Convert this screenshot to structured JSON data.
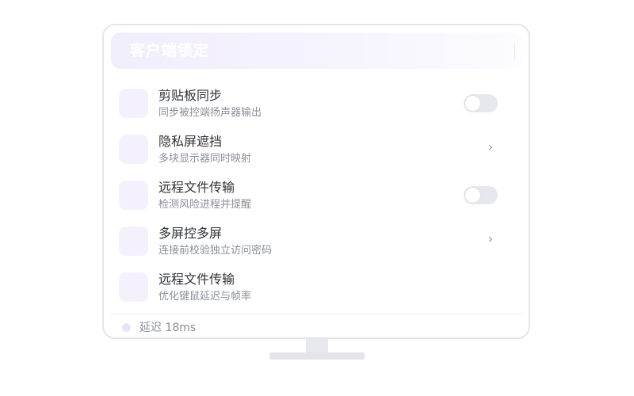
{
  "window": {
    "title": "客户端锁定"
  },
  "items": [
    {
      "title": "剪贴板同步",
      "subtitle": "同步被控端扬声器输出",
      "control": "toggle",
      "toggle_on": false,
      "icon": "app-icon-placeholder"
    },
    {
      "title": "隐私屏遮挡",
      "subtitle": "多块显示器同时映射",
      "control": "chevron",
      "chevron": "›",
      "icon": "app-icon-placeholder"
    },
    {
      "title": "远程文件传输",
      "subtitle": "检测风险进程并提醒",
      "control": "toggle",
      "toggle_on": false,
      "icon": "app-icon-placeholder"
    },
    {
      "title": "多屏控多屏",
      "subtitle": "连接前校验独立访问密码",
      "control": "chevron",
      "chevron": "›",
      "icon": "app-icon-placeholder"
    },
    {
      "title": "远程文件传输",
      "subtitle": "优化键鼠延迟与帧率",
      "control": "none",
      "icon": "app-icon-placeholder"
    }
  ],
  "status": {
    "label": "延迟 18ms",
    "indicator_icon": "status-dot-icon"
  },
  "colors": {
    "accent_tint": "#f4f1fd",
    "title_gradient_start": "#f1eefc",
    "toggle_off": "#e6e8ee",
    "text_primary": "#2f3136",
    "text_secondary": "#8b8f99",
    "border": "#e3e5ea"
  }
}
